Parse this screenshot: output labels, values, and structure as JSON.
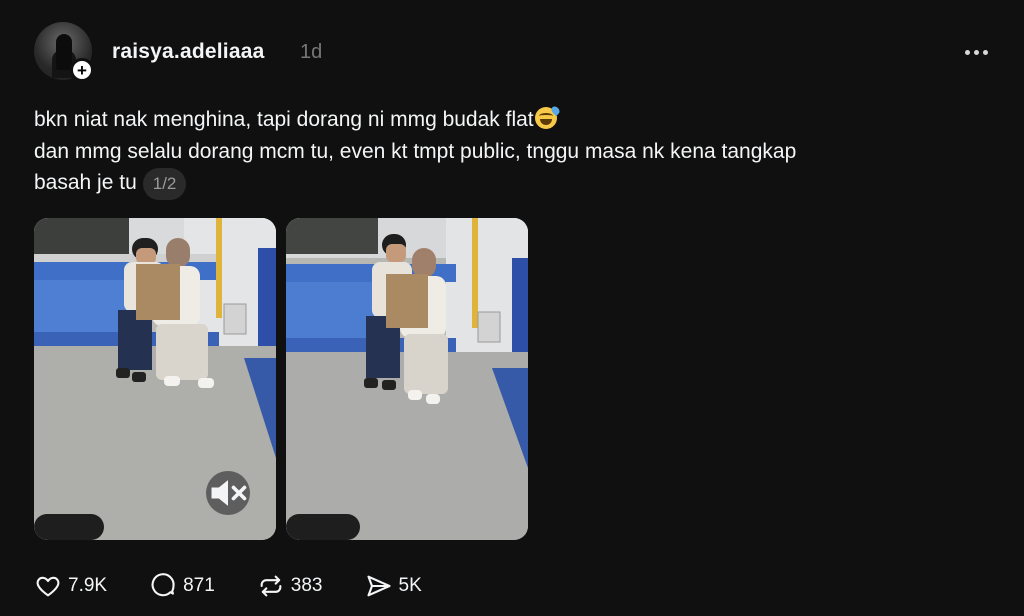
{
  "post": {
    "author": {
      "username": "raisya.adeliaaa",
      "timestamp": "1d",
      "follow_badge": "+"
    },
    "caption": {
      "line1": "bkn niat nak menghina, tapi dorang ni mmg budak flat",
      "line1_emoji": "grinning-face-with-sweat",
      "line2": "dan mmg selalu dorang mcm tu, even kt tmpt public, tnggu masa nk kena tangkap",
      "line3": "basah je tu",
      "page_indicator": "1/2"
    },
    "media": [
      {
        "type": "video",
        "muted": true,
        "icon": "mute-icon"
      },
      {
        "type": "image"
      }
    ],
    "actions": {
      "likes": "7.9K",
      "comments": "871",
      "reposts": "383",
      "shares": "5K"
    }
  }
}
